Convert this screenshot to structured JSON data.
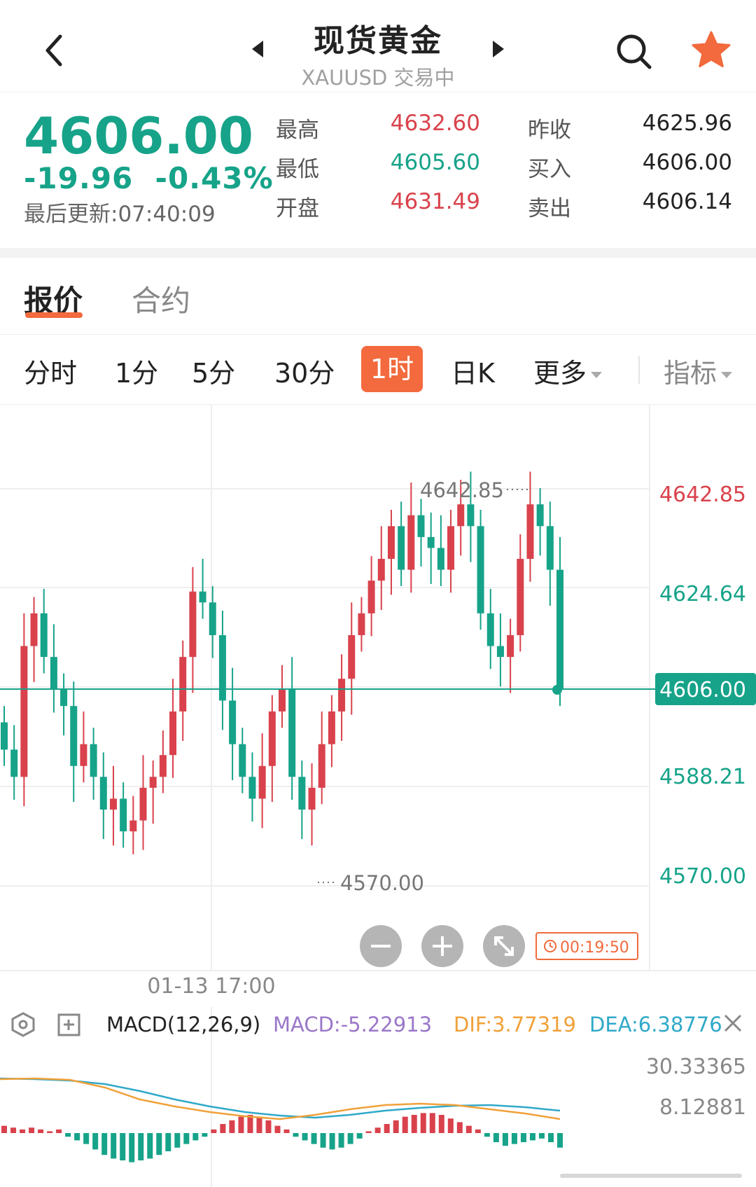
{
  "header": {
    "title": "现货黄金",
    "subtitle": "XAUUSD 交易中"
  },
  "quote": {
    "price": "4606.00",
    "change": "-19.96  -0.43%",
    "updated": "最后更新:07:40:09",
    "stats": [
      {
        "label": "最高",
        "value": "4632.60",
        "color": "red"
      },
      {
        "label": "最低",
        "value": "4605.60",
        "color": "green"
      },
      {
        "label": "开盘",
        "value": "4631.49",
        "color": "red"
      },
      {
        "label": "昨收",
        "value": "4625.96",
        "color": "dark"
      },
      {
        "label": "买入",
        "value": "4606.00",
        "color": "dark"
      },
      {
        "label": "卖出",
        "value": "4606.14",
        "color": "dark"
      }
    ]
  },
  "tabs": {
    "active": "报价",
    "inactive": "合约"
  },
  "periods": {
    "items": [
      "分时",
      "1分",
      "5分",
      "30分",
      "1时",
      "日K",
      "更多"
    ],
    "active": "1时",
    "indicator": "指标"
  },
  "chart": {
    "price_axis": [
      "4642.85",
      "4624.64",
      "4606.00",
      "4588.21",
      "4570.00"
    ],
    "current_price_tag": "4606.00",
    "high_marker": "4642.85",
    "low_marker": "4570.00",
    "countdown": "00:19:50",
    "time_label": "01-13 17:00",
    "macd_title": "MACD(12,26,9)",
    "macd_value": "MACD:-5.22913",
    "dif_value": "DIF:3.77319",
    "dea_value": "DEA:6.38776",
    "macd_axis": [
      "30.33365",
      "8.12881"
    ]
  },
  "colors": {
    "up": "#d9424c",
    "down": "#16a389",
    "accent": "#f26a3d",
    "dif": "#f0a13a",
    "dea": "#30a9c9",
    "macd": "#9a77c9"
  },
  "icons": [
    "back-chevron-icon",
    "prev-triangle-icon",
    "next-triangle-icon",
    "search-icon",
    "star-icon",
    "settings-hexagon-icon",
    "add-indicator-icon",
    "close-icon",
    "zoom-out-icon",
    "zoom-in-icon",
    "fullscreen-icon",
    "clock-icon"
  ]
}
